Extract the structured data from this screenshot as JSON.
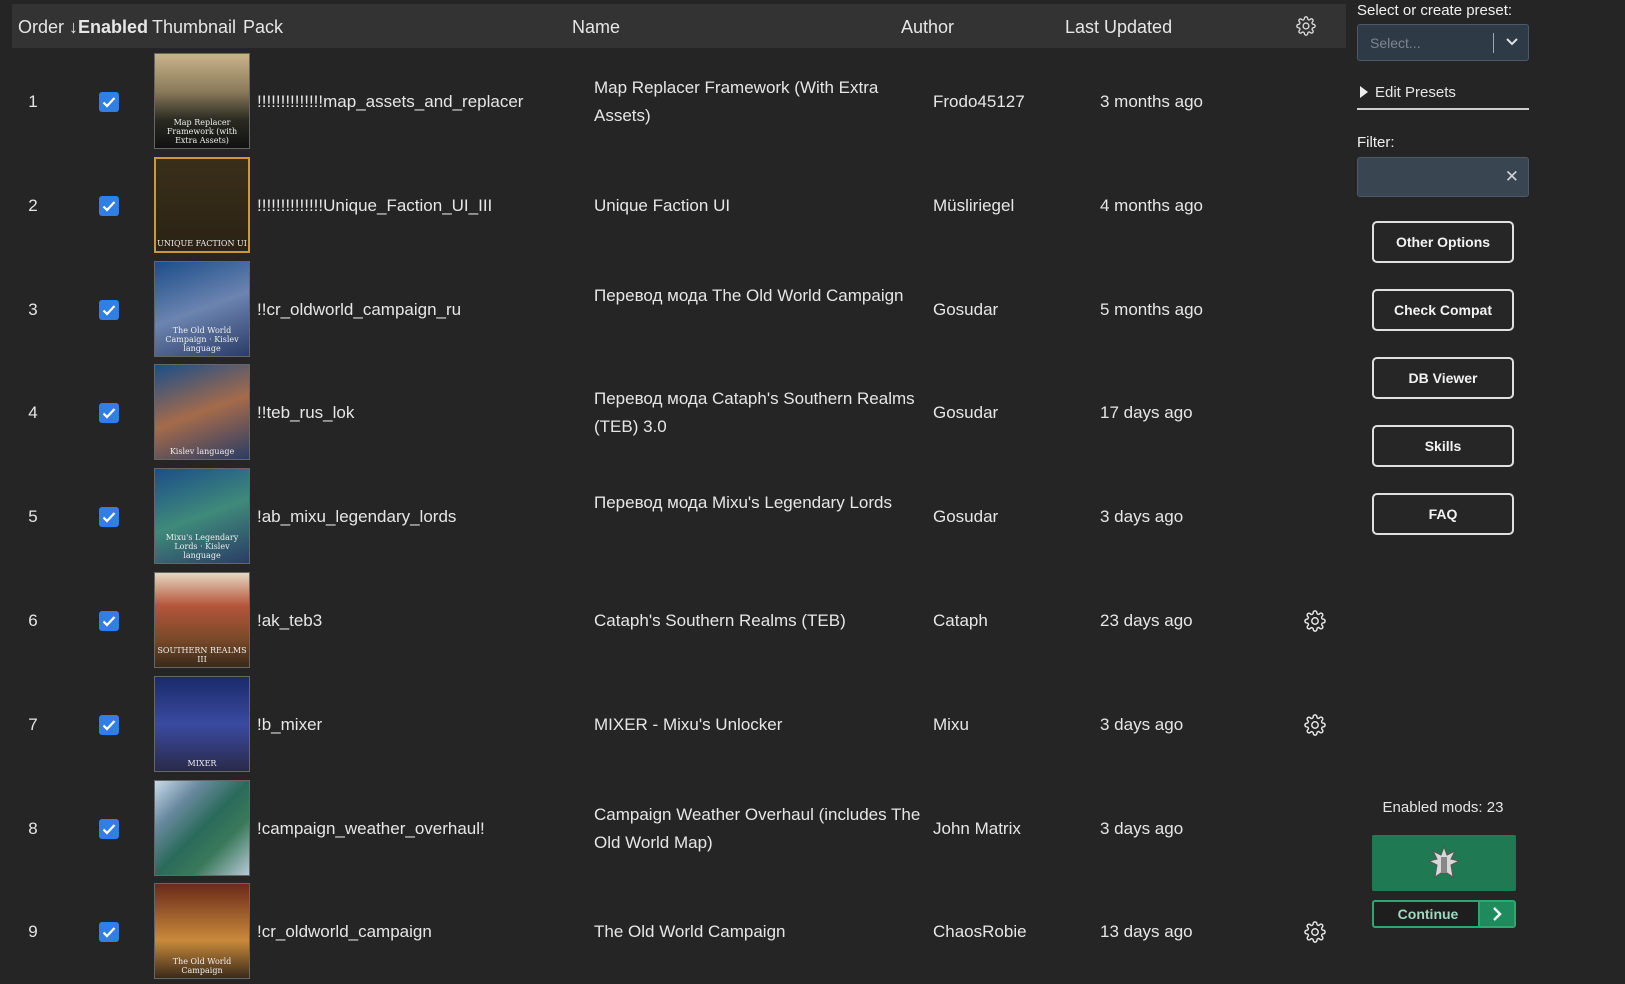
{
  "header": {
    "order": "Order",
    "enabled": "Enabled",
    "sort_arrow": "↓",
    "thumbnail": "Thumbnail",
    "pack": "Pack",
    "name": "Name",
    "author": "Author",
    "last_updated": "Last Updated"
  },
  "rows": [
    {
      "order": "1",
      "enabled": true,
      "pack": "!!!!!!!!!!!!!!map_assets_and_replacer",
      "name": "Map Replacer Framework (With Extra Assets)",
      "author": "Frodo45127",
      "updated": "3 months ago",
      "has_settings": false,
      "thumb_caption": "Map Replacer Framework (with Extra Assets)"
    },
    {
      "order": "2",
      "enabled": true,
      "pack": "!!!!!!!!!!!!!!Unique_Faction_UI_III",
      "name": "Unique Faction UI",
      "author": "Müsliriegel",
      "updated": "4 months ago",
      "has_settings": false,
      "thumb_caption": "UNIQUE FACTION UI"
    },
    {
      "order": "3",
      "enabled": true,
      "pack": "!!cr_oldworld_campaign_ru",
      "name": "Перевод мода The Old World Campaign",
      "author": "Gosudar",
      "updated": "5 months ago",
      "has_settings": false,
      "thumb_caption": "The Old World Campaign · Kislev language"
    },
    {
      "order": "4",
      "enabled": true,
      "pack": "!!teb_rus_lok",
      "name": "Перевод мода Cataph's Southern Realms (TEB) 3.0",
      "author": "Gosudar",
      "updated": "17 days ago",
      "has_settings": false,
      "thumb_caption": "Kislev language"
    },
    {
      "order": "5",
      "enabled": true,
      "pack": "!ab_mixu_legendary_lords",
      "name": "Перевод мода Mixu's Legendary Lords",
      "author": "Gosudar",
      "updated": "3 days ago",
      "has_settings": false,
      "thumb_caption": "Mixu's Legendary Lords · Kislev language"
    },
    {
      "order": "6",
      "enabled": true,
      "pack": "!ak_teb3",
      "name": "Cataph's Southern Realms (TEB)",
      "author": "Cataph",
      "updated": "23 days ago",
      "has_settings": true,
      "thumb_caption": "SOUTHERN REALMS III"
    },
    {
      "order": "7",
      "enabled": true,
      "pack": "!b_mixer",
      "name": "MIXER - Mixu's Unlocker",
      "author": "Mixu",
      "updated": "3 days ago",
      "has_settings": true,
      "thumb_caption": "MIXER"
    },
    {
      "order": "8",
      "enabled": true,
      "pack": "!campaign_weather_overhaul!",
      "name": "Campaign Weather Overhaul (includes The Old World Map)",
      "author": "John Matrix",
      "updated": "3 days ago",
      "has_settings": false,
      "thumb_caption": ""
    },
    {
      "order": "9",
      "enabled": true,
      "pack": "!cr_oldworld_campaign",
      "name": "The Old World Campaign",
      "author": "ChaosRobie",
      "updated": "13 days ago",
      "has_settings": true,
      "thumb_caption": "The Old World Campaign"
    }
  ],
  "sidebar": {
    "preset_label": "Select or create preset:",
    "preset_placeholder": "Select...",
    "edit_presets": "Edit Presets",
    "filter_label": "Filter:",
    "filter_value": "",
    "filter_clear": "✕",
    "buttons": [
      "Other Options",
      "Check Compat",
      "DB Viewer",
      "Skills",
      "FAQ"
    ],
    "enabled_mods": "Enabled mods: 23",
    "continue": "Continue"
  },
  "colors": {
    "accent_blue": "#2f7fe6",
    "play_green": "#1f7a53",
    "header_bg": "#333333",
    "bg": "#252525"
  },
  "thumbs": [
    {
      "bg": "linear-gradient(180deg,#c9b48a 0%,#8a7a5a 40%,#2a2a22 70%,#111 100%)"
    },
    {
      "bg": "linear-gradient(180deg,#3a2f1a,#2a2214)",
      "border": "#c99a3a"
    },
    {
      "bg": "linear-gradient(160deg,#1b4e8a,#6c84b0 50%,#2a3c66)"
    },
    {
      "bg": "linear-gradient(160deg,#1b4e8a,#a56b4a 50%,#2a3c66)"
    },
    {
      "bg": "linear-gradient(160deg,#1b4e8a,#3f8a7a 50%,#2a3c66)"
    },
    {
      "bg": "linear-gradient(180deg,#e6d8c0,#b5553a 35%,#7a4a2a 70%,#3a2a1a)"
    },
    {
      "bg": "linear-gradient(180deg,#1a2a6a,#3a4aa0 50%,#2a2a4a)"
    },
    {
      "bg": "linear-gradient(135deg,#c9dbe8 0%,#6a8aa0 25%,#2a6a5a 50%,#3a7a5a 70%,#b8c8d8 100%)"
    },
    {
      "bg": "linear-gradient(180deg,#6a2a1a,#c98a3a 60%,#3a2a1a)"
    }
  ]
}
